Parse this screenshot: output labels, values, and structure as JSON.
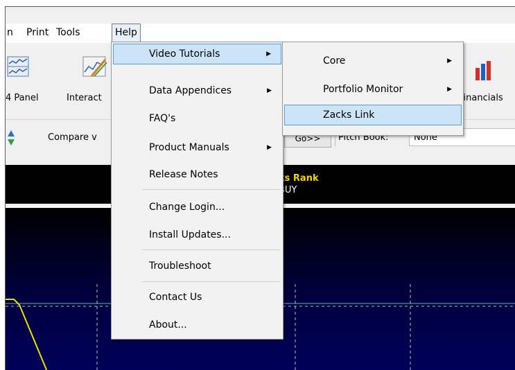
{
  "menubar": {
    "items": [
      {
        "label": "n"
      },
      {
        "label": "Print"
      },
      {
        "label": "Tools"
      },
      {
        "label": "Help"
      }
    ]
  },
  "toolbar": {
    "panel_label": "4 Panel",
    "interact_label": "Interact",
    "financials_label": "Financials"
  },
  "compare": {
    "label": "Compare v",
    "go_label": "Go>>",
    "pitch_label": "Pitch Book:",
    "pitch_value": "None"
  },
  "rank": {
    "title": "ks Rank",
    "value": "BUY"
  },
  "help_menu": {
    "items": [
      {
        "label": "Video Tutorials",
        "submenu": true
      },
      {
        "label": "Data Appendices",
        "submenu": true
      },
      {
        "label": "FAQ's"
      },
      {
        "label": "Product Manuals",
        "submenu": true
      },
      {
        "label": "Release Notes"
      },
      {
        "label": "Change Login..."
      },
      {
        "label": "Install Updates..."
      },
      {
        "label": "Troubleshoot"
      },
      {
        "label": "Contact Us"
      },
      {
        "label": "About..."
      }
    ]
  },
  "sub_menu": {
    "items": [
      {
        "label": "Core",
        "submenu": true
      },
      {
        "label": "Portfolio Monitor",
        "submenu": true
      },
      {
        "label": "Zacks Link"
      }
    ]
  },
  "colors": {
    "highlight": "#cce4f7",
    "highlight_border": "#5a9bd5",
    "rank_title": "#f5d400",
    "chart_line": "#f0e000",
    "grid_line": "#40c0c0"
  }
}
